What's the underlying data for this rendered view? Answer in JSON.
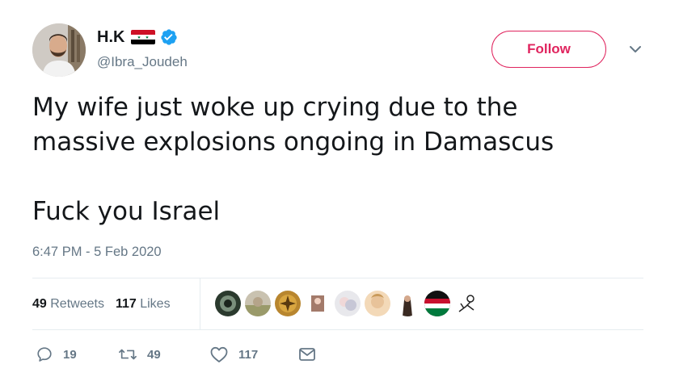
{
  "user": {
    "display_name": "H.K",
    "handle": "@Ibra_Joudeh",
    "verified": true,
    "flag": "syria-flag"
  },
  "follow_button": {
    "label": "Follow"
  },
  "menu_icon": "chevron-down-icon",
  "tweet": {
    "lines": [
      "My wife just woke up crying due to the",
      "massive explosions ongoing in Damascus",
      "Fuck you Israel"
    ],
    "timestamp": "6:47 PM - 5 Feb 2020"
  },
  "stats": {
    "retweets_count": "49",
    "retweets_label": "Retweets",
    "likes_count": "117",
    "likes_label": "Likes",
    "liker_avatars": [
      "liker-avatar",
      "liker-avatar",
      "liker-avatar",
      "liker-avatar",
      "liker-avatar",
      "liker-avatar",
      "liker-avatar",
      "liker-avatar",
      "liker-avatar"
    ]
  },
  "actions": {
    "reply_count": "19",
    "retweet_count": "49",
    "like_count": "117"
  },
  "colors": {
    "accent_follow": "#e0245e",
    "verified": "#1da1f2",
    "secondary_text": "#657786",
    "divider": "#e6ecf0"
  }
}
